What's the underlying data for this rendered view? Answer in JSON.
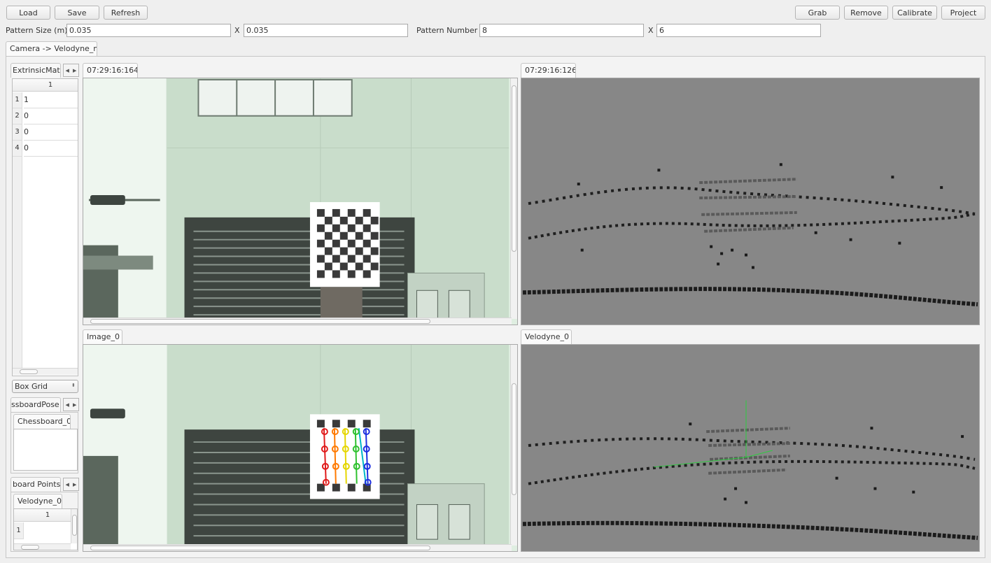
{
  "toolbar": {
    "load": "Load",
    "save": "Save",
    "refresh": "Refresh",
    "grab": "Grab",
    "remove": "Remove",
    "calibrate": "Calibrate",
    "project": "Project"
  },
  "pattern": {
    "size_label": "Pattern Size (m)",
    "size_w": "0.035",
    "size_h": "0.035",
    "number_label": "Pattern Number",
    "number_w": "8",
    "number_h": "6",
    "x_sep": "X"
  },
  "main_tab": "Camera -> Velodyne_m",
  "left": {
    "extrinsic_tab": "ExtrinsicMat",
    "matrix_col": "1",
    "matrix_rows": [
      {
        "idx": "1",
        "val": "1"
      },
      {
        "idx": "2",
        "val": "0"
      },
      {
        "idx": "3",
        "val": "0"
      },
      {
        "idx": "4",
        "val": "0"
      }
    ],
    "grid_select": "Box Grid",
    "pose_tab": "ssboardPose",
    "pose_sub_tab": "Chessboard_0",
    "points_tab": "board Points",
    "points_sub_tab": "Velodyne_0",
    "points_col": "1",
    "points_row": "1"
  },
  "views": {
    "cam_time": "07:29:16:164",
    "velo_time": "07:29:16:126",
    "image_tab": "Image_0",
    "velo_tab": "Velodyne_0"
  },
  "icons": {
    "nav_left": "left-arrow-icon",
    "nav_right": "right-arrow-icon",
    "spin": "spinbox-arrows-icon"
  },
  "colors": {
    "window_bg": "#efefef",
    "velo_bg": "#878787",
    "axis_green": "#2ecc40"
  }
}
